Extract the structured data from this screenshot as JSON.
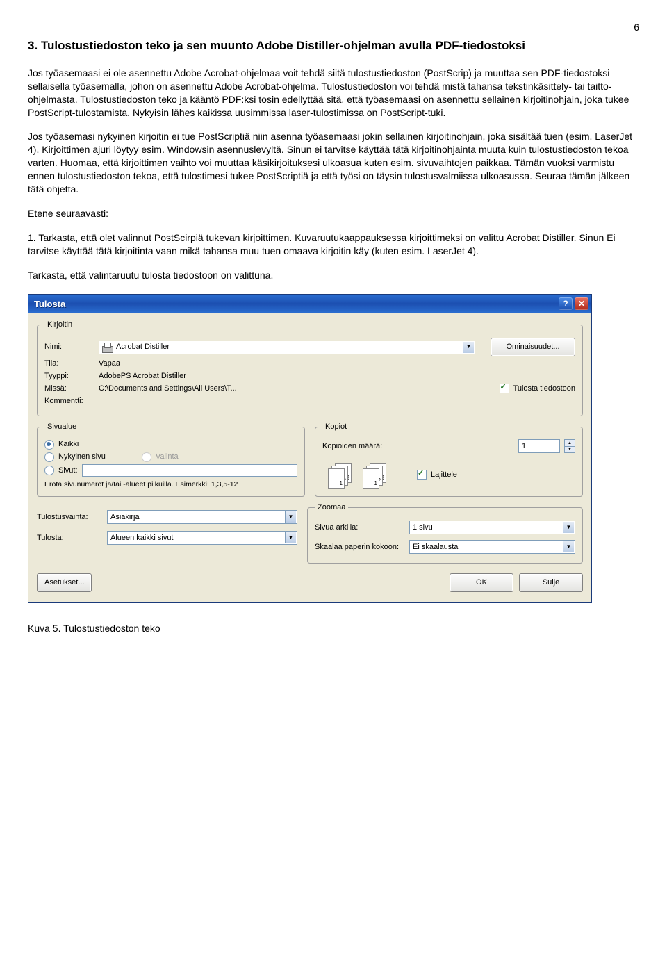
{
  "page_number": "6",
  "section_title": "3.  Tulostustiedoston teko ja sen muunto Adobe Distiller-ohjelman avulla PDF-tiedostoksi",
  "para1": "Jos työasemaasi ei ole asennettu Adobe Acrobat-ohjelmaa voit tehdä siitä tulostustiedoston (PostScrip) ja muuttaa sen PDF-tiedostoksi sellaisella työasemalla, johon on asennettu Adobe Acrobat-ohjelma. Tulostustiedoston voi tehdä mistä tahansa tekstinkäsittely- tai taitto-ohjelmasta. Tulostustiedoston teko ja kääntö PDF:ksi tosin edellyttää sitä, että työasemaasi on asennettu sellainen kirjoitinohjain, joka tukee PostScript-tulostamista. Nykyisin lähes kaikissa uusimmissa laser-tulostimissa on PostScript-tuki.",
  "para2": "Jos työasemasi nykyinen kirjoitin ei tue PostScriptiä niin asenna työasemaasi jokin sellainen kirjoitinohjain, joka sisältää tuen (esim. LaserJet 4). Kirjoittimen ajuri löytyy esim. Windowsin asennuslevyltä. Sinun ei tarvitse käyttää tätä kirjoitinohjainta muuta kuin tulostustiedoston tekoa varten. Huomaa, että kirjoittimen vaihto voi muuttaa käsikirjoituksesi ulkoasua kuten esim. sivuvaihtojen paikkaa. Tämän vuoksi varmistu  ennen tulostustiedoston tekoa, että tulostimesi tukee PostScriptiä ja että työsi on täysin tulostusvalmiissa ulkoasussa. Seuraa tämän jälkeen tätä ohjetta.",
  "para3": "Etene seuraavasti:",
  "para4": "1. Tarkasta, että olet valinnut PostScirpiä tukevan kirjoittimen. Kuvaruutukaappauksessa kirjoittimeksi on valittu Acrobat Distiller. Sinun Ei tarvitse käyttää tätä kirjoitinta vaan mikä tahansa muu tuen omaava kirjoitin käy (kuten esim. LaserJet 4).",
  "para5": "Tarkasta, että valintaruutu tulosta tiedostoon on valittuna.",
  "dialog": {
    "title": "Tulosta",
    "printer_group": "Kirjoitin",
    "name_label": "Nimi:",
    "name_value": "Acrobat Distiller",
    "status_label": "Tila:",
    "status_value": "Vapaa",
    "type_label": "Tyyppi:",
    "type_value": "AdobePS Acrobat Distiller",
    "where_label": "Missä:",
    "where_value": "C:\\Documents and Settings\\All Users\\T...",
    "comment_label": "Kommentti:",
    "properties_button": "Ominaisuudet...",
    "print_to_file": "Tulosta tiedostoon",
    "page_range_group": "Sivualue",
    "all": "Kaikki",
    "current": "Nykyinen sivu",
    "selection": "Valinta",
    "pages": "Sivut:",
    "pages_hint": "Erota sivunumerot ja/tai -alueet pilkuilla. Esimerkki: 1,3,5-12",
    "copies_group": "Kopiot",
    "copies_label": "Kopioiden määrä:",
    "copies_value": "1",
    "collate": "Lajittele",
    "zoom_group": "Zoomaa",
    "pages_per_sheet_label": "Sivua arkilla:",
    "pages_per_sheet_value": "1 sivu",
    "scale_label": "Skaalaa paperin kokoon:",
    "scale_value": "Ei skaalausta",
    "print_what_label": "Tulostusvainta:",
    "print_what_value": "Asiakirja",
    "print_label": "Tulosta:",
    "print_value": "Alueen kaikki sivut",
    "options_button": "Asetukset...",
    "ok_button": "OK",
    "close_button": "Sulje"
  },
  "figure_caption": "Kuva 5. Tulostustiedoston teko"
}
